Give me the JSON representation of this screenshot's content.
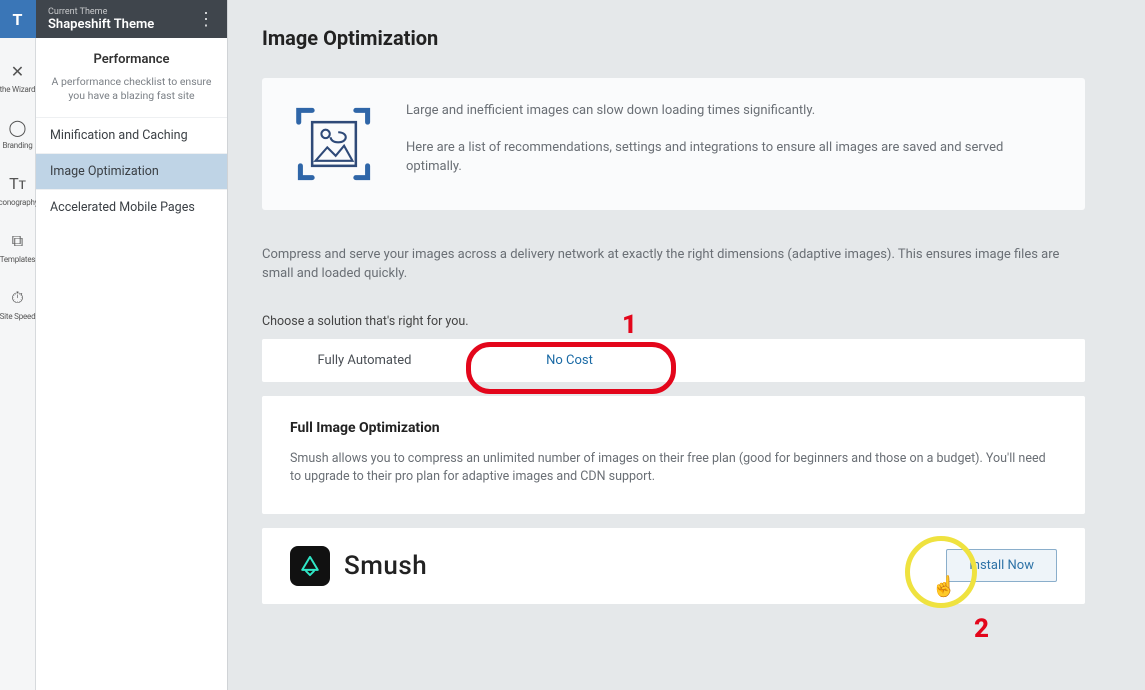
{
  "brand_initial": "T",
  "theme_banner": {
    "pretitle": "Current Theme",
    "name": "Shapeshift Theme"
  },
  "rail": [
    {
      "glyph": "✕",
      "label": "the Wizard"
    },
    {
      "glyph": "◯",
      "label": "Branding"
    },
    {
      "glyph": "Tᴛ",
      "label": "iconography"
    },
    {
      "glyph": "⧉",
      "label": "Templates"
    },
    {
      "glyph": "⏱",
      "label": "Site Speed"
    }
  ],
  "sidebar": {
    "section_title": "Performance",
    "section_sub": "A performance checklist to ensure you have a blazing fast site",
    "items": [
      {
        "label": "Minification and Caching"
      },
      {
        "label": "Image Optimization"
      },
      {
        "label": "Accelerated Mobile Pages"
      }
    ],
    "active_index": 1
  },
  "page": {
    "title": "Image Optimization",
    "info_p1": "Large and inefficient images can slow down loading times significantly.",
    "info_p2": "Here are a list of recommendations, settings and integrations to ensure all images are saved and served optimally.",
    "lead": "Compress and serve your images across a delivery network at exactly the right dimensions (adaptive images). This ensures image files are small and loaded quickly.",
    "choose_label": "Choose a solution that's right for you.",
    "tabs": [
      {
        "label": "Fully Automated"
      },
      {
        "label": "No Cost"
      }
    ],
    "active_tab": 1,
    "details": {
      "heading": "Full Image Optimization",
      "body": "Smush allows you to compress an unlimited number of images on their free plan (good for beginners and those on a budget). You'll need to upgrade to their pro plan for adaptive images and CDN support."
    },
    "product": {
      "name": "Smush"
    },
    "install_label": "Install Now"
  },
  "annotations": {
    "one": "1",
    "two": "2"
  }
}
